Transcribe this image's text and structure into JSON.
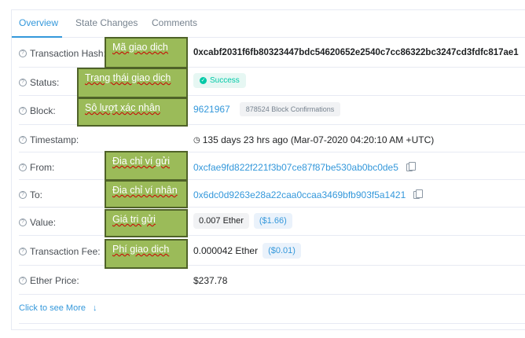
{
  "tabs": [
    "Overview",
    "State Changes",
    "Comments"
  ],
  "rows": {
    "hash": {
      "label": "Transaction Hash:",
      "value": "0xcabf2031f6fb80323447bdc54620652e2540c7cc86322bc3247cd3fdfc817ae1"
    },
    "status": {
      "label": "Status:",
      "value": "Success"
    },
    "block": {
      "label": "Block:",
      "value": "9621967",
      "confirmations": "878524 Block Confirmations"
    },
    "timestamp": {
      "label": "Timestamp:",
      "value": "135 days 23 hrs ago (Mar-07-2020 04:20:10 AM +UTC)"
    },
    "from": {
      "label": "From:",
      "value": "0xcfae9fd822f221f3b07ce87f87be530ab0bc0de5"
    },
    "to": {
      "label": "To:",
      "value": "0x6dc0d9263e28a22caa0ccaa3469bfb903f5a1421"
    },
    "value": {
      "label": "Value:",
      "value": "0.007 Ether",
      "usd": "($1.66)"
    },
    "fee": {
      "label": "Transaction Fee:",
      "value": "0.000042 Ether",
      "usd": "($0.01)"
    },
    "price": {
      "label": "Ether Price:",
      "value": "$237.78"
    }
  },
  "more": "Click to see More",
  "annotations": {
    "hash": "Mã giao dich",
    "status": "Trang thái giao dich",
    "block": "Sô lượt xác nhân",
    "from": "Đia chỉ ví gửi",
    "to": "Đia chỉ ví nhân",
    "value": "Giá tri gửi",
    "fee": "Phí giao dich"
  },
  "colors": {
    "accent": "#3498db",
    "success": "#00c9a7",
    "annotation": "#9bbb59"
  }
}
